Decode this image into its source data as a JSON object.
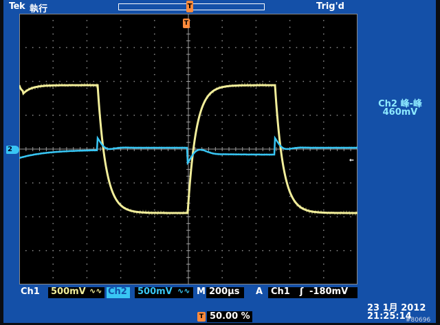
{
  "header": {
    "brand": "Tek",
    "run_state": "執行",
    "trigger_status": "Trig'd",
    "trigger_marker": "T"
  },
  "channel_marker": "2",
  "measurement": {
    "label": "Ch2 峰-峰",
    "value": "460mV"
  },
  "status_bar": {
    "ch1_label": "Ch1",
    "ch1_scale": "500mV",
    "ch1_coupling_icon": "∿∿",
    "ch2_label": "Ch2",
    "ch2_scale": "500mV",
    "ch2_coupling_icon": "∿∿",
    "time_label": "M",
    "time_scale": "200µs",
    "trig_label": "A",
    "trig_source": "Ch1",
    "trig_slope_icon": "ʃ",
    "trig_level": "-180mV"
  },
  "trigger_position": {
    "marker": "T",
    "value": "50.00 %"
  },
  "datetime": {
    "date": "23 1月  2012",
    "time": "21:25:14"
  },
  "watermark": "#80696",
  "colors": {
    "frame": "#1450a8",
    "ch1": "#f2ee9a",
    "ch2": "#39c6f4",
    "trigger": "#ff8a3b"
  }
}
